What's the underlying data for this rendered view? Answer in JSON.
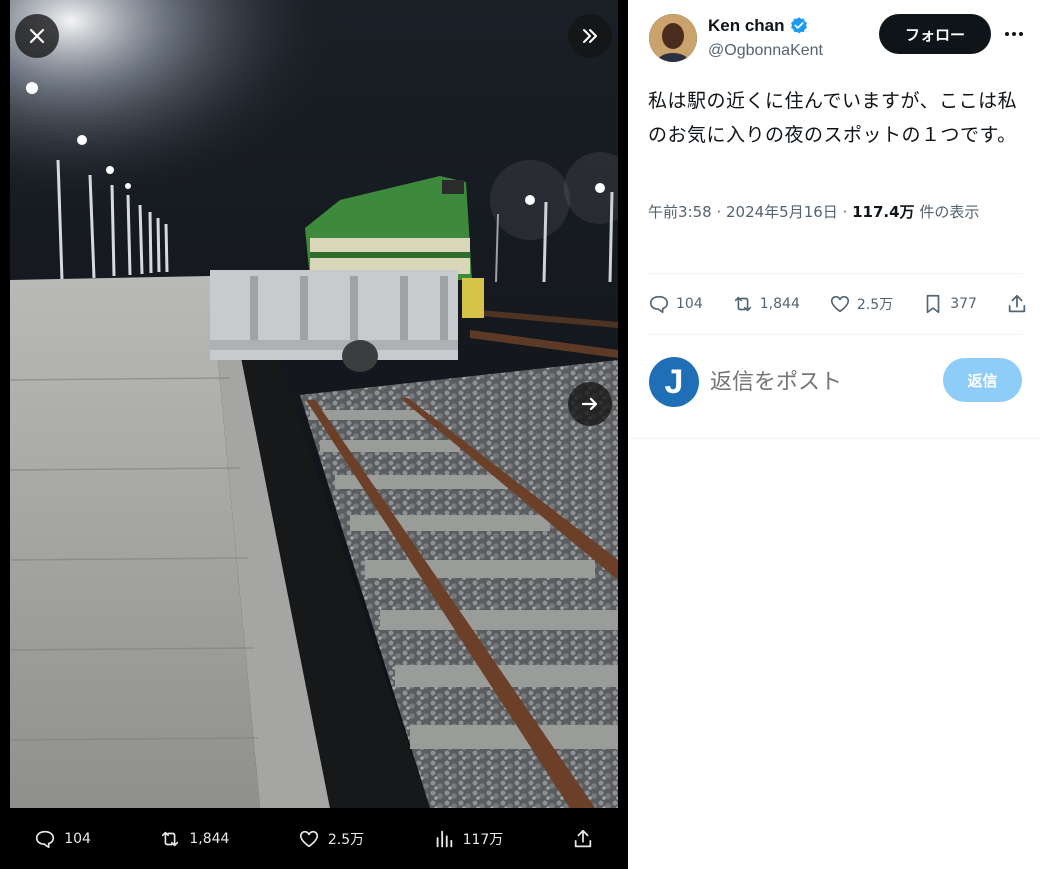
{
  "viewer": {
    "close_icon": "close-icon",
    "collapse_icon": "chevrons-right-icon",
    "next_icon": "arrow-right-icon",
    "actions": {
      "replies": "104",
      "reposts": "1,844",
      "likes": "2.5万",
      "views": "117万"
    }
  },
  "tweet": {
    "author": {
      "display_name": "Ken chan",
      "handle": "@OgbonnaKent",
      "verified": true
    },
    "follow_label": "フォロー",
    "text": "私は駅の近くに住んでいますが、ここは私のお気に入りの夜のスポットの１つです。",
    "timestamp": "午前3:58 · 2024年5月16日 · ",
    "views_count": "117.4万",
    "views_suffix": " 件の表示",
    "actions": {
      "replies": "104",
      "reposts": "1,844",
      "likes": "2.5万",
      "bookmarks": "377"
    }
  },
  "reply": {
    "avatar_letter": "J",
    "placeholder": "返信をポスト",
    "button_label": "返信"
  },
  "colors": {
    "accent": "#1d9bf0",
    "reply_button": "#8ecdf7",
    "follow_button": "#0f1419",
    "secondary_text": "#536471"
  }
}
